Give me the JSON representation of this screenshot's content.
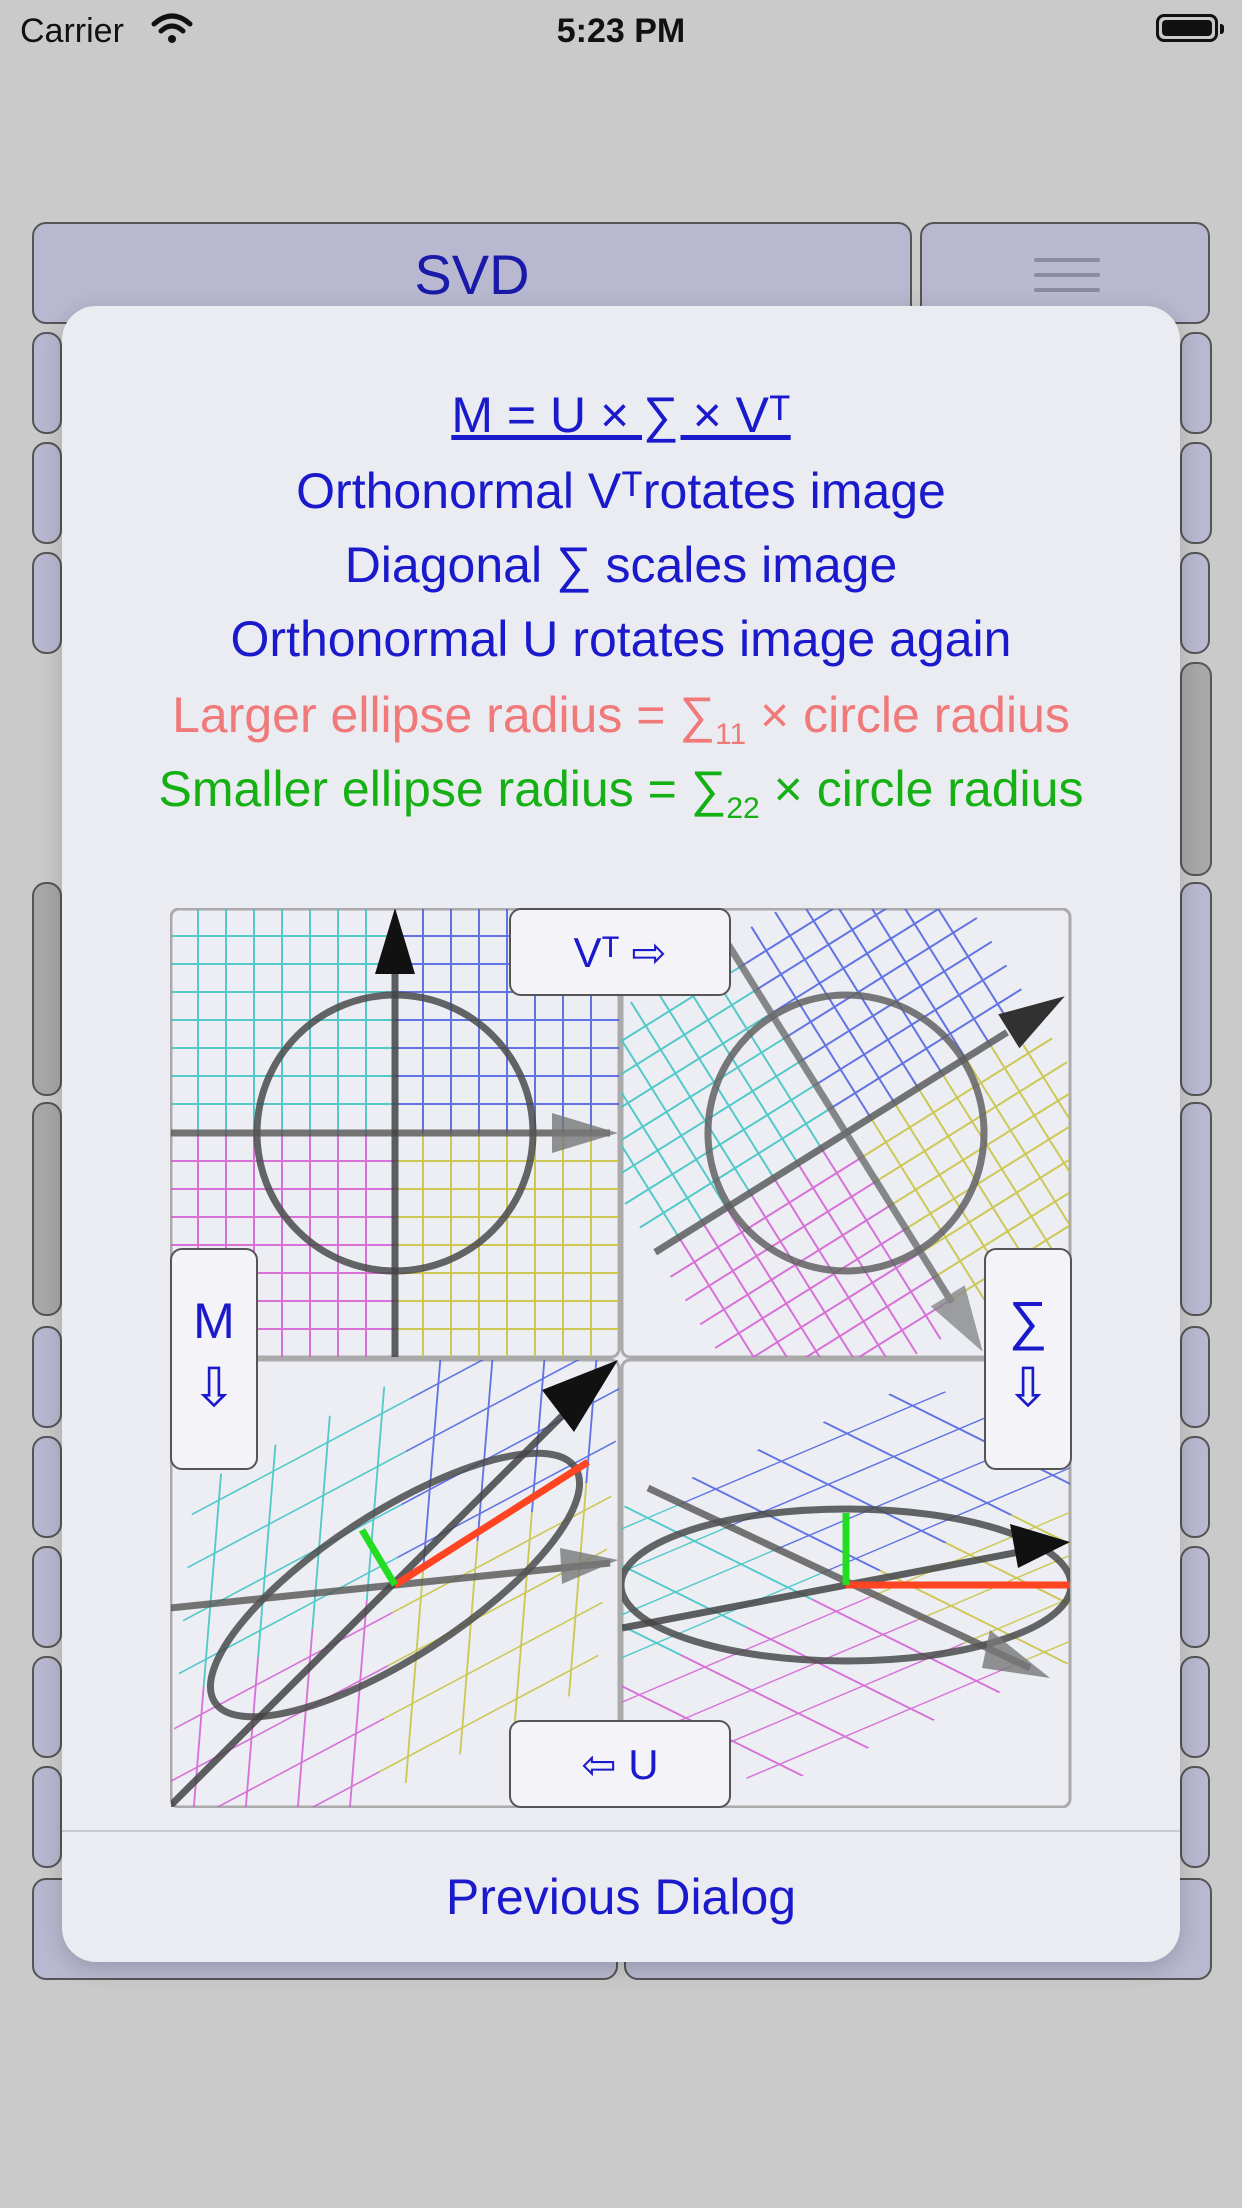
{
  "status_bar": {
    "carrier": "Carrier",
    "time": "5:23 PM"
  },
  "app": {
    "title": "SVD"
  },
  "dialog": {
    "equation": "M = U × ∑ × Vᵀ",
    "line1": "Orthonormal Vᵀrotates image",
    "line2": "Diagonal ∑ scales image",
    "line3": "Orthonormal U rotates image again",
    "line4": {
      "prefix": "Larger ellipse radius = ∑",
      "sub": "11",
      "suffix": " × circle radius"
    },
    "line5": {
      "prefix": "Smaller ellipse radius = ∑",
      "sub": "22",
      "suffix": " × circle radius"
    },
    "buttons": {
      "vt": "Vᵀ ⇨",
      "sigma": "∑",
      "sigma_arrow": "⇩",
      "u": "⇦ U",
      "m": "M",
      "m_arrow": "⇩"
    },
    "previous": "Previous Dialog"
  },
  "colors": {
    "text_blue": "#1a1acc",
    "pink": "#f07a7a",
    "green": "#14b014",
    "grid_cyan": "#39c3c3",
    "grid_blue": "#4a5ee0",
    "grid_magenta": "#d45cd4",
    "grid_yellow": "#c8c23a"
  },
  "icons": [
    "wifi-icon",
    "battery-icon",
    "hamburger-menu-icon",
    "right-arrow-icon",
    "left-arrow-icon",
    "down-arrow-icon"
  ]
}
